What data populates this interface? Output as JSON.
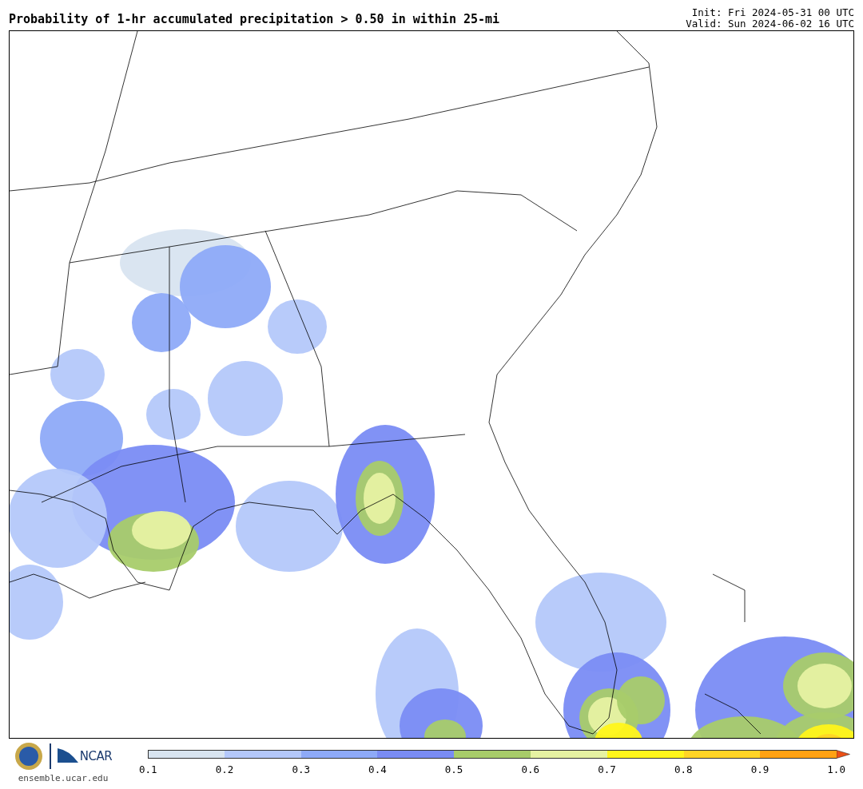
{
  "title": "Probability of 1-hr accumulated precipitation > 0.50 in within 25-mi",
  "init": "Init: Fri 2024-05-31 00 UTC",
  "valid": "Valid: Sun 2024-06-02 16 UTC",
  "logo": {
    "text": "NCAR",
    "url": "ensemble.ucar.edu"
  },
  "colorbar": {
    "segments": [
      {
        "kind": "band",
        "color": "#d8e4f0"
      },
      {
        "kind": "band",
        "color": "#b4c8fa"
      },
      {
        "kind": "band",
        "color": "#8eaaf8"
      },
      {
        "kind": "band",
        "color": "#7a8cf4"
      },
      {
        "kind": "band",
        "color": "#a8cc6a"
      },
      {
        "kind": "band",
        "color": "#e6f2a2"
      },
      {
        "kind": "band",
        "color": "#fff51a"
      },
      {
        "kind": "band",
        "color": "#ffd426"
      },
      {
        "kind": "band",
        "color": "#ffa214"
      },
      {
        "kind": "arrow",
        "color": "#ec5016"
      }
    ],
    "ticks": [
      "0.1",
      "0.2",
      "0.3",
      "0.4",
      "0.5",
      "0.6",
      "0.7",
      "0.8",
      "0.9",
      "1.0"
    ]
  }
}
